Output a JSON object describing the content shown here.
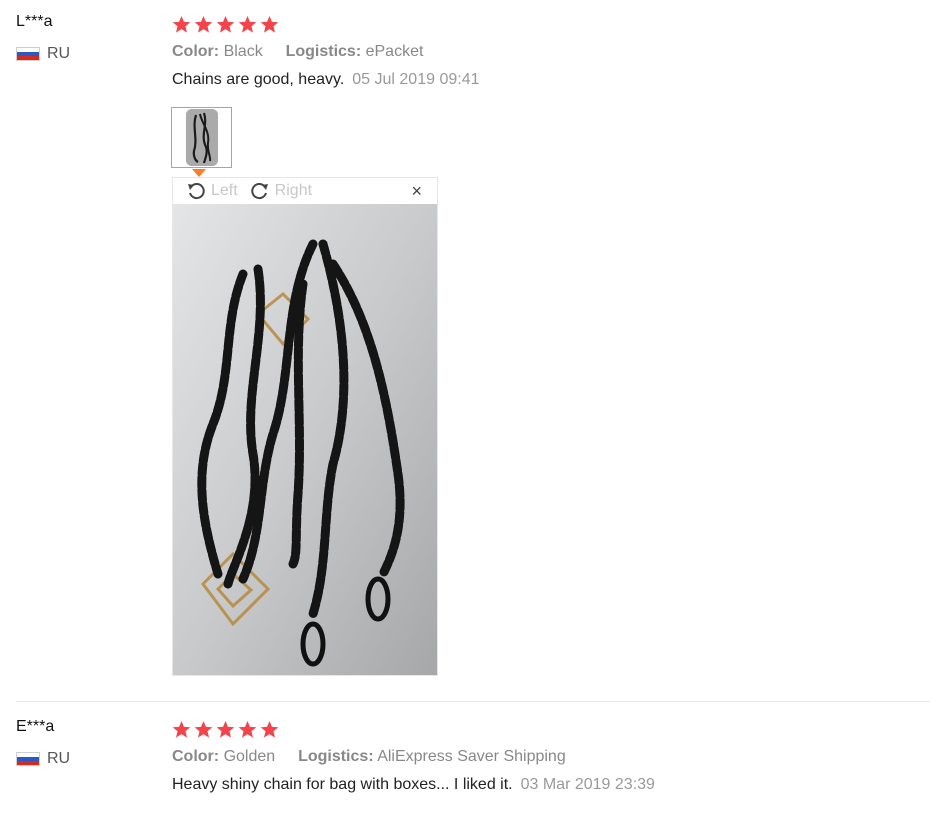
{
  "reviews": [
    {
      "user": "L***a",
      "country": "RU",
      "rating": 5,
      "color_label": "Color:",
      "color_value": "Black",
      "logistics_label": "Logistics:",
      "logistics_value": "ePacket",
      "text": "Chains are good, heavy.",
      "date": "05 Jul 2019 09:41"
    },
    {
      "user": "E***a",
      "country": "RU",
      "rating": 5,
      "color_label": "Color:",
      "color_value": "Golden",
      "logistics_label": "Logistics:",
      "logistics_value": "AliExpress Saver Shipping",
      "text": "Heavy shiny chain for bag with boxes... I liked it.",
      "date": "03 Mar 2019 23:39"
    }
  ],
  "viewer": {
    "rotate_left": "Left",
    "rotate_right": "Right",
    "close_symbol": "×"
  },
  "colors": {
    "star": "#f4434b",
    "thumb_border": "#ff8c3a",
    "caret": "#ff7a2a"
  }
}
